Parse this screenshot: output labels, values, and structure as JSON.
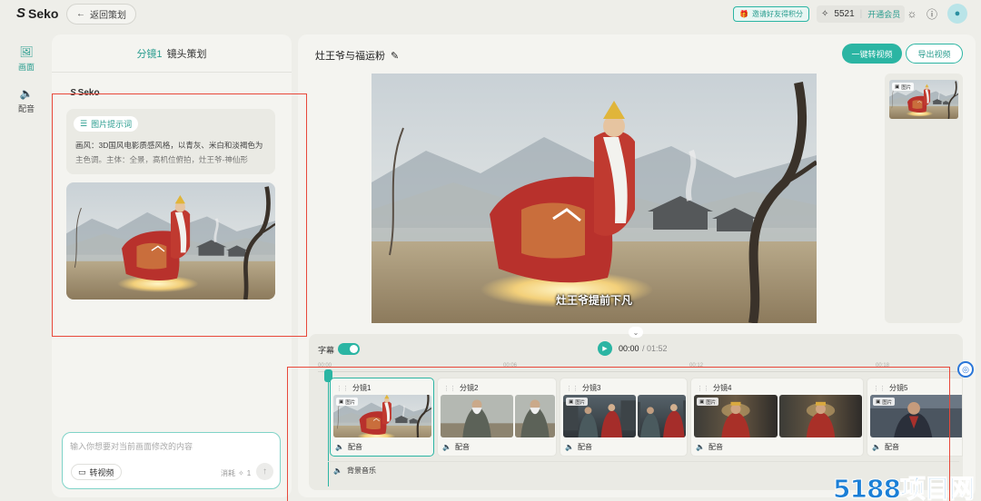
{
  "app": {
    "logo": "Seko",
    "back_label": "返回策划"
  },
  "topbar": {
    "invite_label": "邀请好友得积分",
    "points": "5521",
    "vip_label": "开通会员"
  },
  "rail": {
    "items": [
      {
        "label": "画面"
      },
      {
        "label": "配音"
      }
    ]
  },
  "plan": {
    "shot_label": "分镜1",
    "panel_title": "镜头策划",
    "seko_label": "Seko",
    "prompt_tag": "图片提示词",
    "prompt_text": "画风：3D国风电影质感风格，以青灰、米白和淡褐色为主色调。主体：全景，高机位俯拍，灶王爷-神仙形"
  },
  "chat": {
    "placeholder": "输入你想要对当前画面修改的内容",
    "to_video_label": "转视频",
    "cost_label": "消耗",
    "cost_value": "1"
  },
  "editor": {
    "title": "灶王爷与福运粉",
    "primary_btn": "一键转视频",
    "export_btn": "导出视频",
    "subtitle": "灶王爷提前下凡"
  },
  "timeline": {
    "subtitle_label": "字幕",
    "time_current": "00:00",
    "time_total": "/ 01:52",
    "ticks": [
      "00:00",
      "00:06",
      "00:12",
      "00:18"
    ],
    "image_badge": "图片",
    "audio_label": "配音",
    "bgm_label": "背景音乐",
    "clips": [
      {
        "name": "分镜1"
      },
      {
        "name": "分镜2"
      },
      {
        "name": "分镜3"
      },
      {
        "name": "分镜4"
      },
      {
        "name": "分镜5"
      }
    ]
  },
  "watermark": "5188项目网",
  "colors": {
    "accent": "#2bb5a3",
    "annotation": "#e8483a"
  }
}
